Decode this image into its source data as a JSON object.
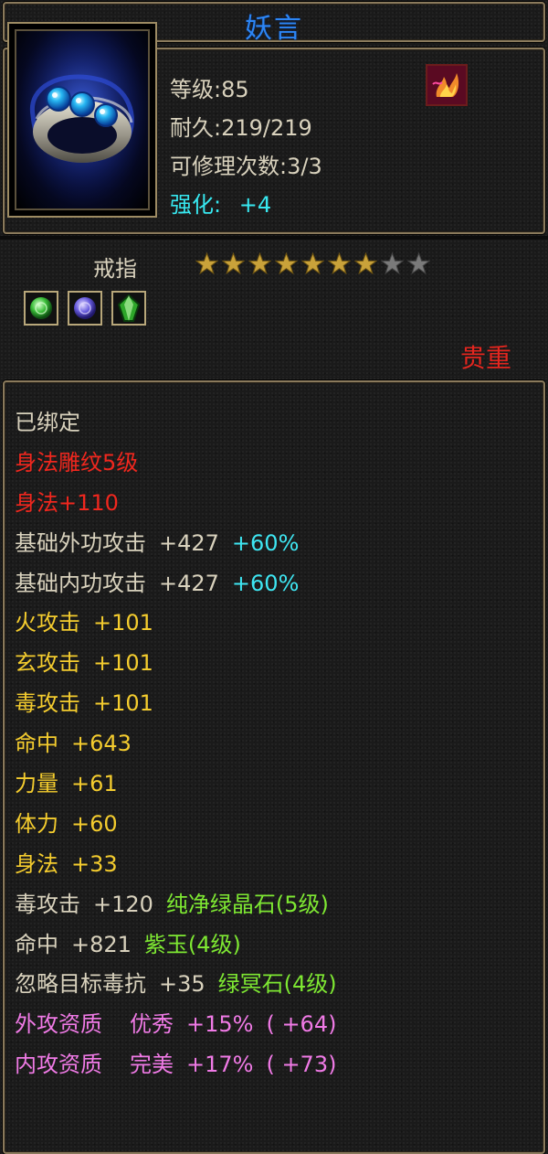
{
  "item": {
    "name": "妖言",
    "level": "等级:85",
    "durability": "耐久:219/219",
    "repairs": "可修理次数:3/3",
    "enhance_label": "强化:",
    "enhance_value": "+4",
    "type": "戒指",
    "rarity": "贵重",
    "stars": {
      "filled": 7,
      "total": 9
    },
    "icon": "jeweled-ring-icon",
    "badge_icon": "flame-badge-icon",
    "gem_sockets": [
      "green-gem-icon",
      "purple-gem-icon",
      "green-crystal-icon"
    ]
  },
  "attributes": [
    {
      "name": "已绑定",
      "color": "white"
    },
    {
      "name": "身法雕纹5级",
      "color": "red"
    },
    {
      "name": "身法+110",
      "color": "red"
    },
    {
      "name": "基础外功攻击",
      "value": "+427",
      "extra": "+60%",
      "color": "white",
      "extra_color": "cyan"
    },
    {
      "name": "基础内功攻击",
      "value": "+427",
      "extra": "+60%",
      "color": "white",
      "extra_color": "cyan"
    },
    {
      "name": "火攻击",
      "value": "+101",
      "color": "yellow"
    },
    {
      "name": "玄攻击",
      "value": "+101",
      "color": "yellow"
    },
    {
      "name": "毒攻击",
      "value": "+101",
      "color": "yellow"
    },
    {
      "name": "命中",
      "value": "+643",
      "color": "yellow"
    },
    {
      "name": "力量",
      "value": "+61",
      "color": "yellow"
    },
    {
      "name": "体力",
      "value": "+60",
      "color": "yellow"
    },
    {
      "name": "身法",
      "value": "+33",
      "color": "yellow"
    },
    {
      "name": "毒攻击",
      "value": "+120",
      "extra": "纯净绿晶石(5级)",
      "color": "white",
      "extra_color": "green"
    },
    {
      "name": "命中",
      "value": "+821",
      "extra": "紫玉(4级)",
      "color": "white",
      "extra_color": "green"
    },
    {
      "name": "忽略目标毒抗",
      "value": "+35",
      "extra": "绿冥石(4级)",
      "color": "white",
      "extra_color": "green"
    },
    {
      "name": "外攻资质",
      "grade": "优秀",
      "value": "+15%",
      "bonus": "( +64)",
      "color": "pink"
    },
    {
      "name": "内攻资质",
      "grade": "完美",
      "value": "+17%",
      "bonus": "( +73)",
      "color": "pink"
    }
  ],
  "colors": {
    "white": "#d9d2bd",
    "red": "#f0271e",
    "yellow": "#f4cc2e",
    "green": "#7ee832",
    "cyan": "#3ee6f2",
    "pink": "#f07ae6",
    "title": "#2c86f5",
    "star_filled": "#c9a23a",
    "star_empty": "#7a7a7a"
  }
}
